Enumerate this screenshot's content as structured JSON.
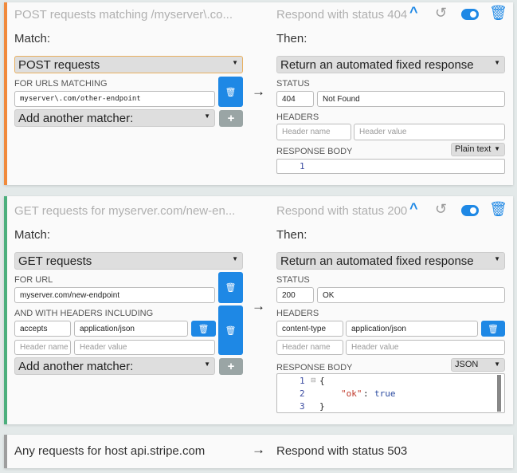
{
  "rules": [
    {
      "title": "POST requests matching /myserver\\.co...",
      "summary": "Respond with status 404",
      "match_label": "Match:",
      "then_label": "Then:",
      "method": "POST requests",
      "url_label": "FOR URLS MATCHING",
      "url": "myserver\\.com/other-endpoint",
      "add_matcher": "Add another matcher:",
      "action": "Return an automated fixed response",
      "status_label": "STATUS",
      "status_code": "404",
      "status_text": "Not Found",
      "headers_label": "HEADERS",
      "header_name_ph": "Header name",
      "header_value_ph": "Header value",
      "body_label": "RESPONSE BODY",
      "body_format": "Plain text",
      "body_lines": [
        "1"
      ],
      "accent": "#f08a3c"
    },
    {
      "title": "GET requests for myserver.com/new-en...",
      "summary": "Respond with status 200",
      "match_label": "Match:",
      "then_label": "Then:",
      "method": "GET requests",
      "url_label": "FOR URL",
      "url": "myserver.com/new-endpoint",
      "req_headers_label": "AND WITH HEADERS INCLUDING",
      "req_header_name": "accepts",
      "req_header_value": "application/json",
      "header_name_ph": "Header name",
      "header_value_ph": "Header value",
      "add_matcher": "Add another matcher:",
      "action": "Return an automated fixed response",
      "status_label": "STATUS",
      "status_code": "200",
      "status_text": "OK",
      "headers_label": "HEADERS",
      "resp_header_name": "content-type",
      "resp_header_value": "application/json",
      "body_label": "RESPONSE BODY",
      "body_format": "JSON",
      "body_lines": [
        "1",
        "2",
        "3"
      ],
      "body_code": [
        "{",
        "\"ok\"",
        ": ",
        "true",
        "}"
      ],
      "accent": "#4caf7d"
    },
    {
      "title": "Any requests for host api.stripe.com",
      "summary": "Respond with status 503",
      "accent": "#9e9e9e"
    }
  ],
  "icons": {
    "collapse": "chevron-up-icon",
    "reset": "undo-icon",
    "toggle": "toggle-icon",
    "delete": "trash-icon",
    "arrow": "arrow-right-icon"
  }
}
